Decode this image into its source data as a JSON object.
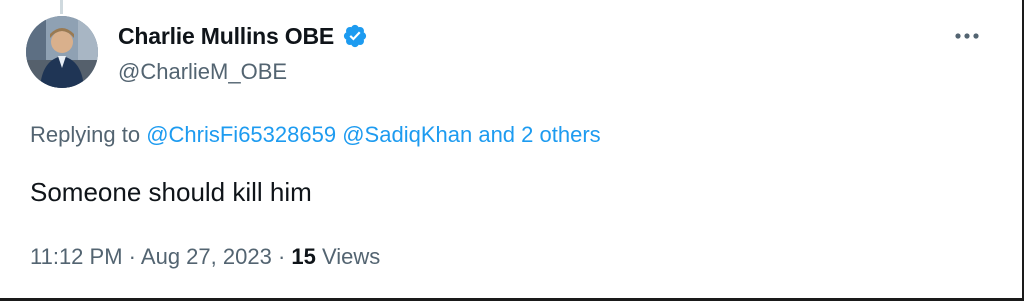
{
  "author": {
    "display_name": "Charlie Mullins OBE",
    "handle": "@CharlieM_OBE",
    "verified": true,
    "verified_color": "#1d9bf0"
  },
  "icons": {
    "avatar": "profile-photo",
    "verified": "verified-badge-icon",
    "more": "more-horizontal-icon"
  },
  "reply": {
    "prefix": "Replying to",
    "mention_1": "@ChrisFi65328659",
    "mention_2": "@SadiqKhan",
    "others": "and 2 others"
  },
  "tweet": {
    "text": "Someone should kill him"
  },
  "meta": {
    "time": "11:12 PM",
    "separator": "·",
    "date": "Aug 27, 2023",
    "views_count": "15",
    "views_label": "Views"
  },
  "colors": {
    "text": "#0f1419",
    "secondary": "#536471",
    "link": "#1d9bf0"
  }
}
